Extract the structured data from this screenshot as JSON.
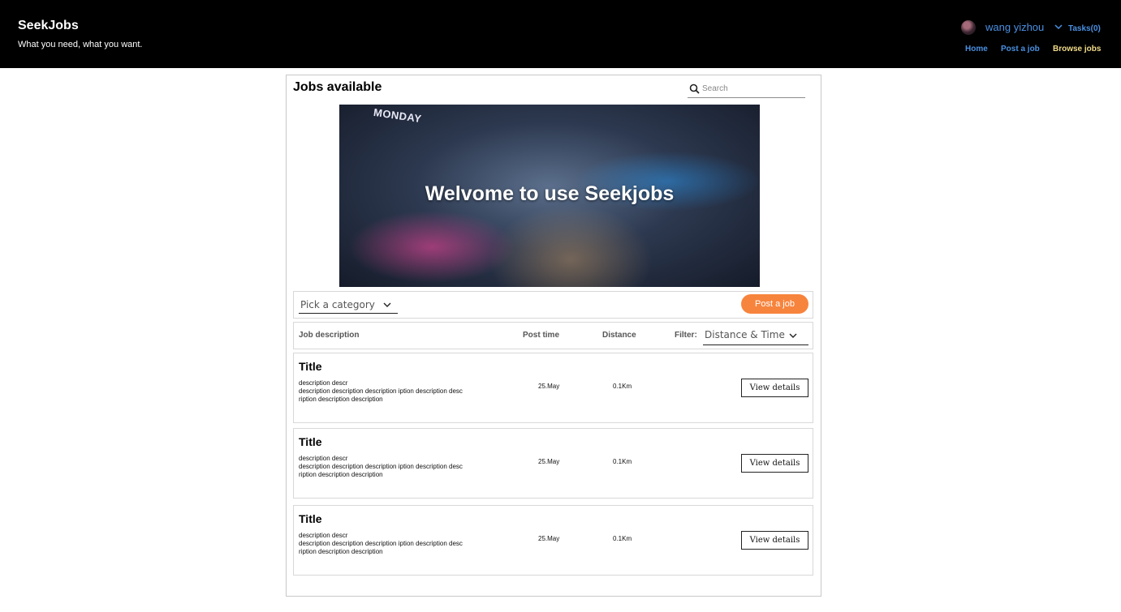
{
  "header": {
    "brand": "SeekJobs",
    "tagline": "What you need, what you want.",
    "username": "wang yizhou",
    "tasks": "Tasks(0)",
    "nav": {
      "home": "Home",
      "post": "Post a job",
      "browse": "Browse jobs"
    }
  },
  "main": {
    "title": "Jobs available",
    "search_placeholder": "Search",
    "hero_sign": "MONDAY",
    "hero_title": "Welvome to use Seekjobs",
    "category_label": "Pick a category",
    "post_button": "Post a job"
  },
  "table": {
    "headers": {
      "desc": "Job description",
      "post": "Post time",
      "dist": "Distance",
      "filter": "Filter:"
    },
    "filter_value": "Distance & Time"
  },
  "jobs": [
    {
      "title": "Title",
      "desc1": "description descr",
      "desc2": "description description description iption description desc",
      "desc3": "ription description description",
      "time": "25.May",
      "distance": "0.1Km",
      "button": "View details"
    },
    {
      "title": "Title",
      "desc1": "description descr",
      "desc2": "description description description iption description desc",
      "desc3": "ription description description",
      "time": "25.May",
      "distance": "0.1Km",
      "button": "View details"
    },
    {
      "title": "Title",
      "desc1": "description descr",
      "desc2": "description description description iption description desc",
      "desc3": "ription description description",
      "time": "25.May",
      "distance": "0.1Km",
      "button": "View details"
    }
  ],
  "colors": {
    "accent_blue": "#4a90e2",
    "accent_orange": "#f7843d",
    "browse_yellow": "#f2dc8a"
  },
  "icons": {
    "search": "search-icon",
    "user_menu": "chevron-down-icon",
    "avatar": "avatar"
  }
}
